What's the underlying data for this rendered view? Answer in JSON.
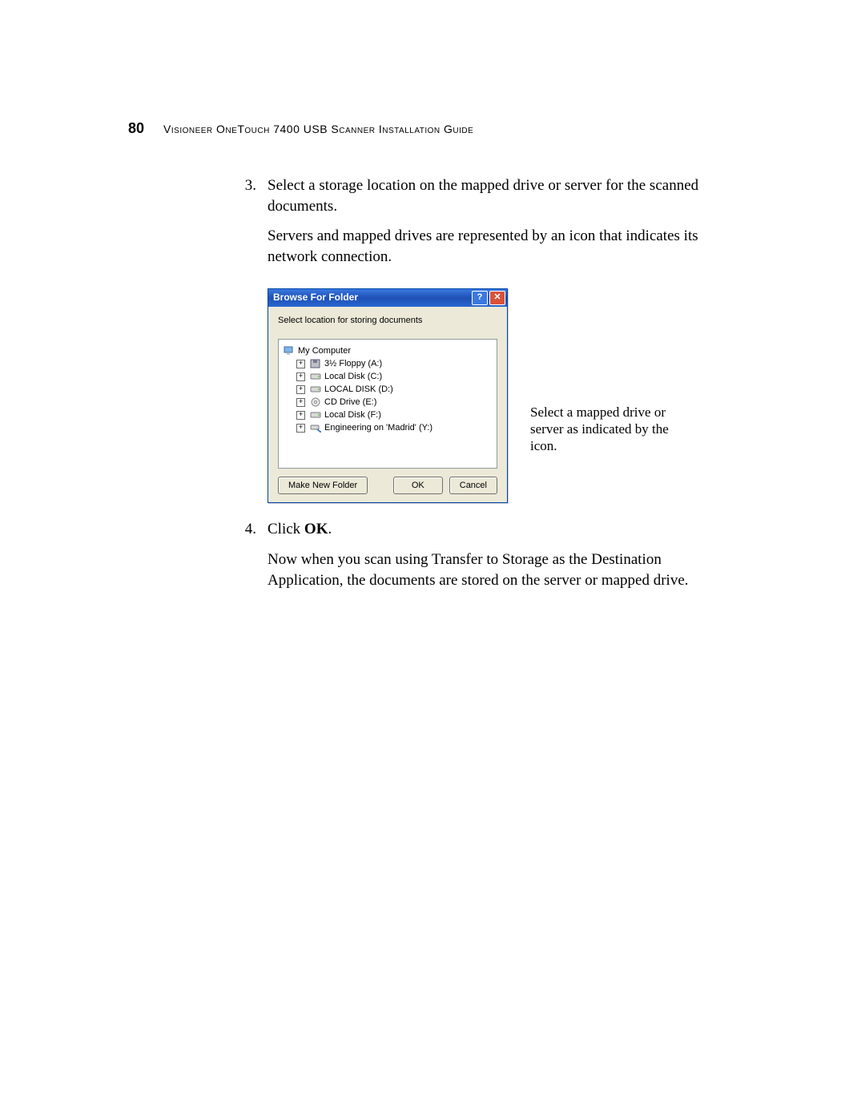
{
  "header": {
    "page_number": "80",
    "title": "Visioneer OneTouch 7400 USB Scanner Installation Guide"
  },
  "steps": {
    "s3": {
      "num": "3.",
      "p1": "Select a storage location on the mapped drive or server for the scanned documents.",
      "p2": "Servers and mapped drives are represented by an icon that indicates its network connection."
    },
    "s4": {
      "num": "4.",
      "lead": "Click ",
      "bold": "OK",
      "period": ".",
      "p2": "Now when you scan using Transfer to Storage as the Destination Application, the documents are stored on the server or mapped drive."
    }
  },
  "annotation": "Select a mapped drive or server as indicated by the icon.",
  "dialog": {
    "title": "Browse For Folder",
    "help": "?",
    "close": "✕",
    "instruction": "Select location for storing documents",
    "tree": {
      "root": "My Computer",
      "items": [
        {
          "label": "3½ Floppy (A:)",
          "icon": "floppy"
        },
        {
          "label": "Local Disk (C:)",
          "icon": "hdd"
        },
        {
          "label": "LOCAL DISK (D:)",
          "icon": "hdd"
        },
        {
          "label": "CD Drive (E:)",
          "icon": "cd"
        },
        {
          "label": "Local Disk (F:)",
          "icon": "hdd"
        },
        {
          "label": "Engineering on 'Madrid' (Y:)",
          "icon": "net"
        }
      ]
    },
    "buttons": {
      "make_new": "Make New Folder",
      "ok": "OK",
      "cancel": "Cancel"
    }
  }
}
